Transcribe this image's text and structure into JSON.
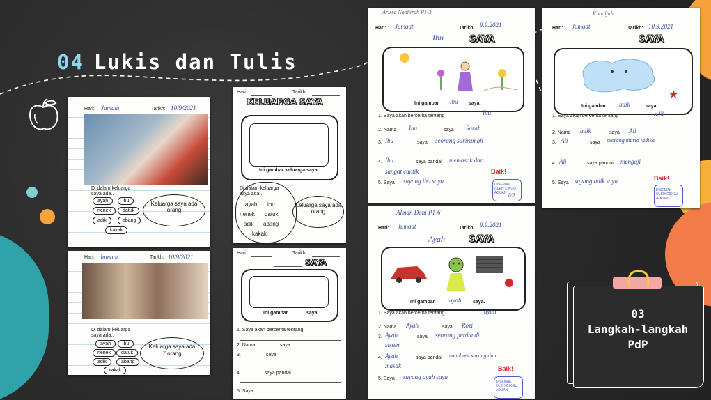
{
  "slide": {
    "title_number": "04",
    "title_text": "Lukis dan Tulis"
  },
  "card": {
    "number": "03",
    "line1": "Langkah-langkah",
    "line2": "PdP"
  },
  "worksheet_labels": {
    "hari": "Hari:",
    "tarikh": "Tarikh:",
    "keluarga_saya": "KELUARGA SAYA",
    "saya": "SAYA",
    "ini_gambar_keluarga": "Ini gambar keluarga saya.",
    "ini_gambar": "Ini gambar",
    "saya_dot": "saya.",
    "di_dalam_keluarga": "Di dalam keluarga saya ada..",
    "ayah": "ayah",
    "ibu": "ibu",
    "nenek": "nenek",
    "datuk": "datuk",
    "adik": "adik",
    "abang": "abang",
    "kakak": "kakak",
    "keluarga_saya_ada": "Keluarga saya ada",
    "orang": "orang",
    "q1": "1. Saya akan bercerita tentang",
    "q2": "2. Nama",
    "q2b": "saya",
    "q3": "3.",
    "q3b": "saya",
    "q4": "4.",
    "q4b": "saya pandai",
    "q5": "5. Saya",
    "baik": "Baik!",
    "disemak": "DISEMAK OLEH CIKGU ADUAN"
  },
  "student_entries": {
    "ws1_hari": "Jumaat",
    "ws1_tarikh": "10/9/2021",
    "ws2_hari": "Jumaat",
    "ws2_tarikh": "10/9/2021",
    "ws2_orang": "7",
    "ibu_name": "Arissa Nadhirah P1-3",
    "ibu_hari": "Jumaat",
    "ibu_tarikh": "9.9.2021",
    "ibu_title": "Ibu",
    "ibu_gambar": "ibu",
    "ibu_q1": "Ibu",
    "ibu_q2a": "Ibu",
    "ibu_q2b": "Sarah",
    "ibu_q3a": "Ibu",
    "ibu_q3b": "seorang surirumah",
    "ibu_q4a": "Ibu",
    "ibu_q4b": "memasak dan",
    "ibu_q4c": "sangat cantik",
    "ibu_q5": "sayang ibu saya",
    "ibu_tarikh_stamp": "8/9",
    "adik_name": "Khadijah",
    "adik_hari": "Jumaat",
    "adik_tarikh": "10.9.2021",
    "adik_gambar": "adik",
    "adik_q1": "adik",
    "adik_q2a": "adik",
    "adik_q2b": "Ali",
    "adik_q3a": "Ali",
    "adik_q3b": "seorang murid tadika",
    "adik_q4a": "Ali",
    "adik_q4b": "mengaji",
    "adik_q5": "sayang adik saya",
    "ayah_name": "Alman Dani P1-6",
    "ayah_hari": "Jumaat",
    "ayah_tarikh": "9.9.2021",
    "ayah_title": "Ayah",
    "ayah_gambar": "ayah",
    "ayah_q1": "ayah",
    "ayah_q2a": "Ayah",
    "ayah_q2b": "Rozi",
    "ayah_q3a": "Ayah",
    "ayah_q3b": "seorang perdandi",
    "ayah_q3c": "sistem",
    "ayah_q4a": "Ayah",
    "ayah_q4b": "membuat sarung dan",
    "ayah_q4c": "masak",
    "ayah_q5": "sayang ayah saya"
  },
  "colors": {
    "background": "#2c2c2c",
    "title_number": "#8fd6ef",
    "teal": "#2fa3a7",
    "orange": "#f7a23b",
    "coral": "#f47c4a",
    "pink": "#f3a7a3",
    "ink_blue": "#3b4e9c",
    "teacher_red": "#d9262c"
  },
  "icons": {
    "apple": "apple-doodle-icon",
    "star": "star-icon"
  }
}
